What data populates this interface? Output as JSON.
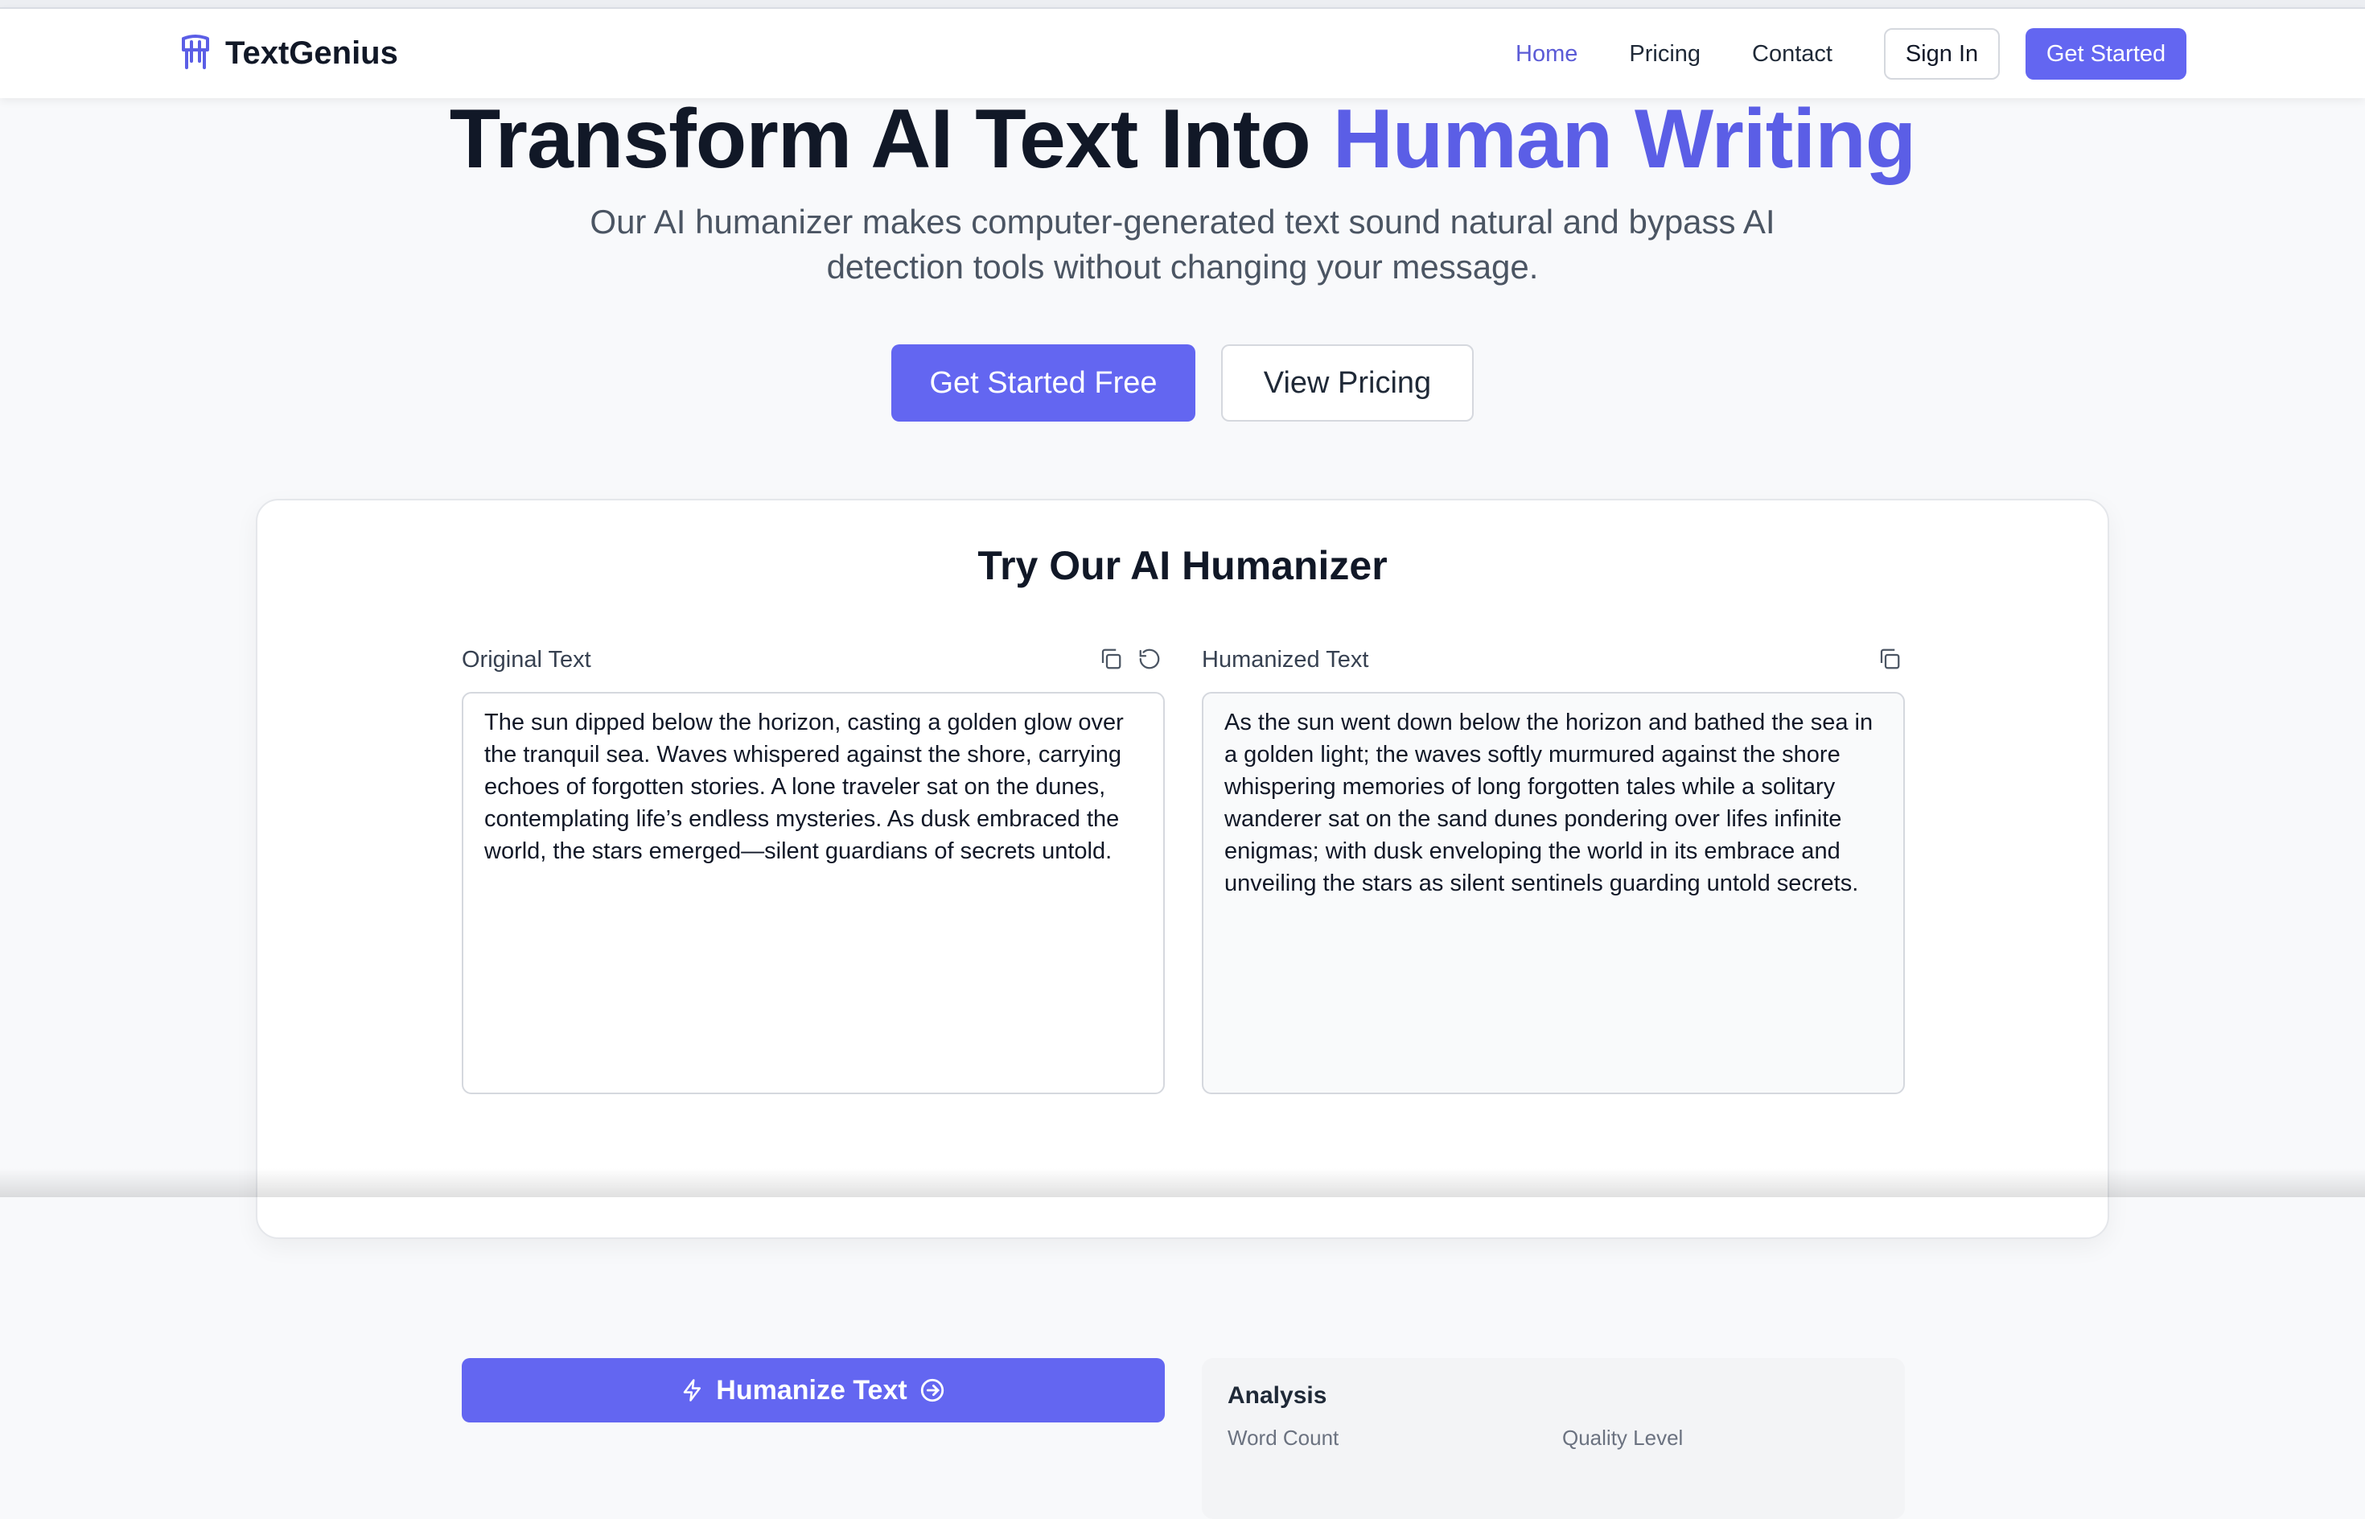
{
  "header": {
    "brand": "TextGenius",
    "brand_icon": "brand-logo-icon",
    "nav": [
      {
        "label": "Home",
        "active": true
      },
      {
        "label": "Pricing",
        "active": false
      },
      {
        "label": "Contact",
        "active": false
      }
    ],
    "sign_in": "Sign In",
    "get_started": "Get Started"
  },
  "hero": {
    "title_plain": "Transform AI Text Into ",
    "title_accent": "Human Writing",
    "subtitle": "Our AI humanizer makes computer-generated text sound natural and bypass AI detection tools without changing your message.",
    "primary_cta": "Get Started Free",
    "secondary_cta": "View Pricing"
  },
  "tool": {
    "title": "Try Our AI Humanizer",
    "original_label": "Original Text",
    "original_text": "The sun dipped below the horizon, casting a golden glow over the tranquil sea. Waves whispered against the shore, carrying echoes of forgotten stories. A lone traveler sat on the dunes, contemplating life’s endless mysteries. As dusk embraced the world, the stars emerged—silent guardians of secrets untold.",
    "humanized_label": "Humanized Text",
    "humanized_text": "As the sun went down below the horizon and bathed the sea in a golden light; the waves softly murmured against the shore whispering memories of long forgotten tales while a solitary wanderer sat on the sand dunes pondering over lifes infinite enigmas; with dusk enveloping the world in its embrace and unveiling the stars as silent sentinels guarding untold secrets.",
    "humanize_button": "Humanize Text",
    "analysis_title": "Analysis",
    "analysis_labels": [
      "Word Count",
      "Quality Level"
    ]
  },
  "colors": {
    "accent": "#6366f1",
    "accent_text": "#5b5ee6"
  }
}
